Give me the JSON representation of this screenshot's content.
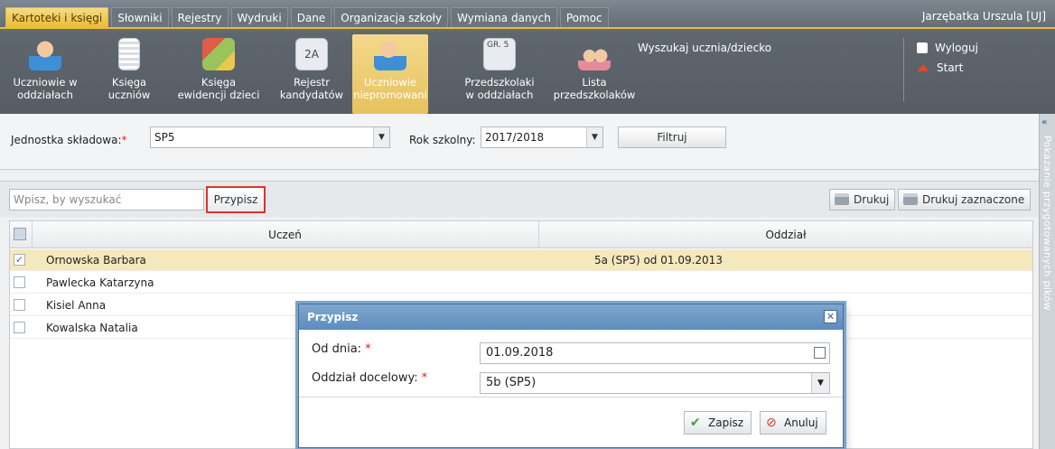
{
  "menu": {
    "tabs": [
      {
        "label": "Kartoteki i księgi",
        "active": true
      },
      {
        "label": "Słowniki",
        "active": false
      },
      {
        "label": "Rejestry",
        "active": false
      },
      {
        "label": "Wydruki",
        "active": false
      },
      {
        "label": "Dane",
        "active": false
      },
      {
        "label": "Organizacja szkoły",
        "active": false
      },
      {
        "label": "Wymiana danych",
        "active": false
      },
      {
        "label": "Pomoc",
        "active": false
      }
    ],
    "user": "Jarzębatka Urszula [UJ]"
  },
  "ribbon": {
    "buttons": [
      {
        "line1": "Uczniowie w",
        "line2": "oddziałach",
        "icon": "student-icon"
      },
      {
        "line1": "Księga",
        "line2": "uczniów",
        "icon": "book-icon"
      },
      {
        "line1": "Księga",
        "line2": "ewidencji dzieci",
        "icon": "children-register-icon"
      },
      {
        "line1": "Rejestr",
        "line2": "kandydatów",
        "icon": "candidates-register-icon"
      },
      {
        "line1": "Uczniowie",
        "line2": "niepromowani",
        "icon": "unpromoted-student-icon"
      },
      {
        "line1": "Przedszkolaki",
        "line2": "w oddziałach",
        "icon": "preschool-group-icon"
      },
      {
        "line1": "Lista",
        "line2": "przedszkolaków",
        "icon": "preschool-list-icon"
      }
    ],
    "icon_labels": {
      "class_badge": "2A",
      "group_badge": "GR. 5"
    },
    "search_student_label": "Wyszukaj ucznia/dziecko",
    "logout_label": "Wyloguj",
    "start_label": "Start"
  },
  "filter": {
    "unit_label": "Jednostka składowa:",
    "unit_value": "SP5",
    "year_label": "Rok szkolny:",
    "year_value": "2017/2018",
    "filter_button": "Filtruj",
    "required_mark": "*"
  },
  "side_panel": {
    "label": "Pokazanie przygotowanych pików"
  },
  "toolbar": {
    "search_placeholder": "Wpisz, by wyszukać",
    "assign_button": "Przypisz",
    "print_button": "Drukuj",
    "print_selected_button": "Drukuj zaznaczone"
  },
  "grid": {
    "columns": [
      "Uczeń",
      "Oddział"
    ],
    "rows": [
      {
        "name": "Ornowska Barbara",
        "oddzial": "5a (SP5) od 01.09.2013",
        "checked": true
      },
      {
        "name": "Pawlecka Katarzyna",
        "oddzial": "",
        "checked": false
      },
      {
        "name": "Kisiel Anna",
        "oddzial": "",
        "checked": false
      },
      {
        "name": "Kowalska Natalia",
        "oddzial": "",
        "checked": false
      }
    ]
  },
  "dialog": {
    "title": "Przypisz",
    "date_label": "Od dnia:",
    "date_value": "01.09.2018",
    "target_label": "Oddział docelowy:",
    "target_value": "5b (SP5)",
    "save_button": "Zapisz",
    "cancel_button": "Anuluj"
  },
  "colors": {
    "accent": "#e9bd38",
    "dialog_header": "#6b97c4",
    "highlight_border": "#e0312c",
    "selected_row": "#f6e8bd"
  }
}
